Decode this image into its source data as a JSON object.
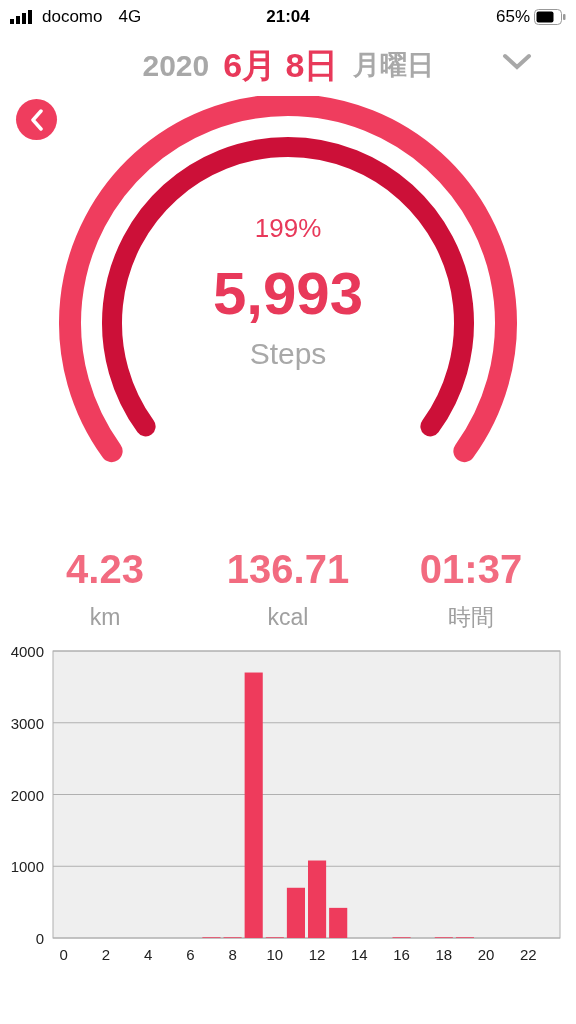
{
  "status_bar": {
    "carrier": "docomo",
    "network": "4G",
    "time": "21:04",
    "battery": "65%"
  },
  "header": {
    "year": "2020",
    "date": "6月 8日",
    "weekday": "月曜日"
  },
  "gauge": {
    "percent": "199%",
    "steps": "5,993",
    "unit": "Steps"
  },
  "stats": [
    {
      "value": "4.23",
      "unit": "km"
    },
    {
      "value": "136.71",
      "unit": "kcal"
    },
    {
      "value": "01:37",
      "unit": "時間"
    }
  ],
  "chart": {
    "chart_data": {
      "type": "bar",
      "x": [
        0,
        1,
        2,
        3,
        4,
        5,
        6,
        7,
        8,
        9,
        10,
        11,
        12,
        13,
        14,
        15,
        16,
        17,
        18,
        19,
        20,
        21,
        22,
        23
      ],
      "values": [
        0,
        0,
        0,
        0,
        0,
        0,
        0,
        10,
        10,
        3700,
        10,
        700,
        1080,
        420,
        0,
        0,
        10,
        0,
        10,
        10,
        0,
        0,
        0,
        0
      ],
      "xlim": [
        -0.5,
        23.5
      ],
      "ylim": [
        0,
        4000
      ],
      "xticks": [
        0,
        2,
        4,
        6,
        8,
        10,
        12,
        14,
        16,
        18,
        20,
        22
      ],
      "yticks": [
        0,
        1000,
        2000,
        3000,
        4000
      ],
      "grid": true
    }
  }
}
